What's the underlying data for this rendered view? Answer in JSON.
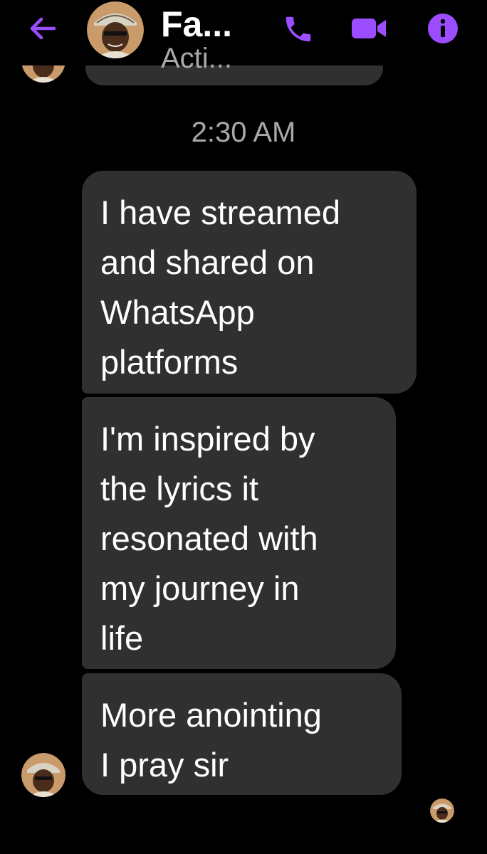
{
  "header": {
    "back_icon": "arrow-left-icon",
    "contact_name": "Fa...",
    "status": "Acti...",
    "call_icon": "phone-icon",
    "video_icon": "video-camera-icon",
    "info_icon": "info-icon",
    "accent_color": "#9b4dff"
  },
  "conversation": {
    "timestamp": "2:30 AM",
    "messages": [
      {
        "text": "I have streamed\nand shared on\nWhatsApp\nplatforms"
      },
      {
        "text": "I'm inspired by\nthe lyrics it\nresonated with\nmy journey in\nlife"
      },
      {
        "text": "More anointing\nI pray sir"
      }
    ],
    "bubble_color": "#303030"
  }
}
